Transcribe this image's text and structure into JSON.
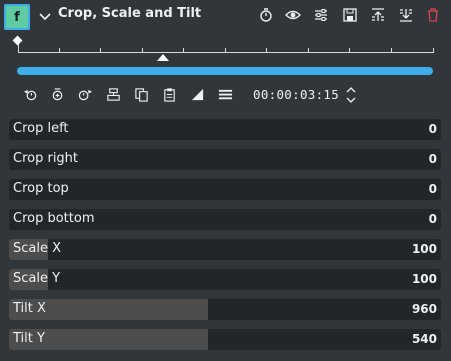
{
  "effect": {
    "title": "Crop, Scale and Tilt",
    "fx_badge": "f",
    "colors": {
      "accent": "#3daee9",
      "badge": "#5fcba0",
      "delete": "#da4453",
      "panel": "#31363b",
      "field": "#232629",
      "fill": "#4d4d4d"
    }
  },
  "header_icons": [
    "stopwatch-icon",
    "eye-icon",
    "sliders-icon",
    "save-icon",
    "collapse-up-icon",
    "collapse-down-icon",
    "delete-icon"
  ],
  "toolbar": {
    "icons": [
      "previous-keyframe-icon",
      "add-keyframe-icon",
      "next-keyframe-icon",
      "align-icon",
      "copy-icon",
      "paste-icon",
      "interpolation-icon",
      "menu-icon"
    ],
    "timecode": "00:00:03:15"
  },
  "params": [
    {
      "label": "Crop left",
      "value": "0",
      "fill": 0
    },
    {
      "label": "Crop right",
      "value": "0",
      "fill": 0
    },
    {
      "label": "Crop top",
      "value": "0",
      "fill": 0
    },
    {
      "label": "Crop bottom",
      "value": "0",
      "fill": 0
    },
    {
      "label": "Scale X",
      "value": "100",
      "fill": 0.09
    },
    {
      "label": "Scale Y",
      "value": "100",
      "fill": 0.09
    },
    {
      "label": "Tilt X",
      "value": "960",
      "fill": 0.46
    },
    {
      "label": "Tilt Y",
      "value": "540",
      "fill": 0.46
    }
  ]
}
